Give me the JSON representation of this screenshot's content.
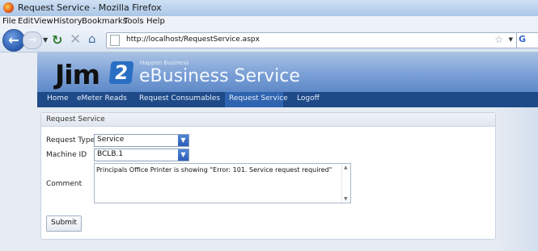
{
  "window": {
    "title": "Request Service - Mozilla Firefox"
  },
  "menubar": {
    "items": [
      "File",
      "Edit",
      "View",
      "History",
      "Bookmarks",
      "Tools",
      "Help"
    ]
  },
  "toolbar": {
    "back_icon": "back-arrow-icon",
    "forward_icon": "forward-arrow-icon",
    "reload_icon": "reload-icon",
    "stop_icon": "stop-icon",
    "home_icon": "home-icon",
    "url": "http://localhost/RequestService.aspx"
  },
  "brand": {
    "logo_text": "Jim",
    "logo_number": "2",
    "tagline": "Happen Business",
    "product": "eBusiness Service",
    "colors": {
      "banner": "#7ba0d6",
      "menu": "#1e4a88",
      "active_tab": "#2f64b0"
    }
  },
  "nav": {
    "items": [
      "Home",
      "eMeter Reads",
      "Request Consumables",
      "Request Service",
      "Logoff"
    ],
    "active": "Request Service"
  },
  "panel": {
    "title": "Request Service",
    "request_type": {
      "label": "Request Type",
      "value": "Service"
    },
    "machine_id": {
      "label": "Machine ID",
      "value": "BCLB.1"
    },
    "comment": {
      "label": "Comment",
      "value": "Principals Office Printer is showing \"Error: 101. Service request required\""
    },
    "submit_label": "Submit"
  }
}
